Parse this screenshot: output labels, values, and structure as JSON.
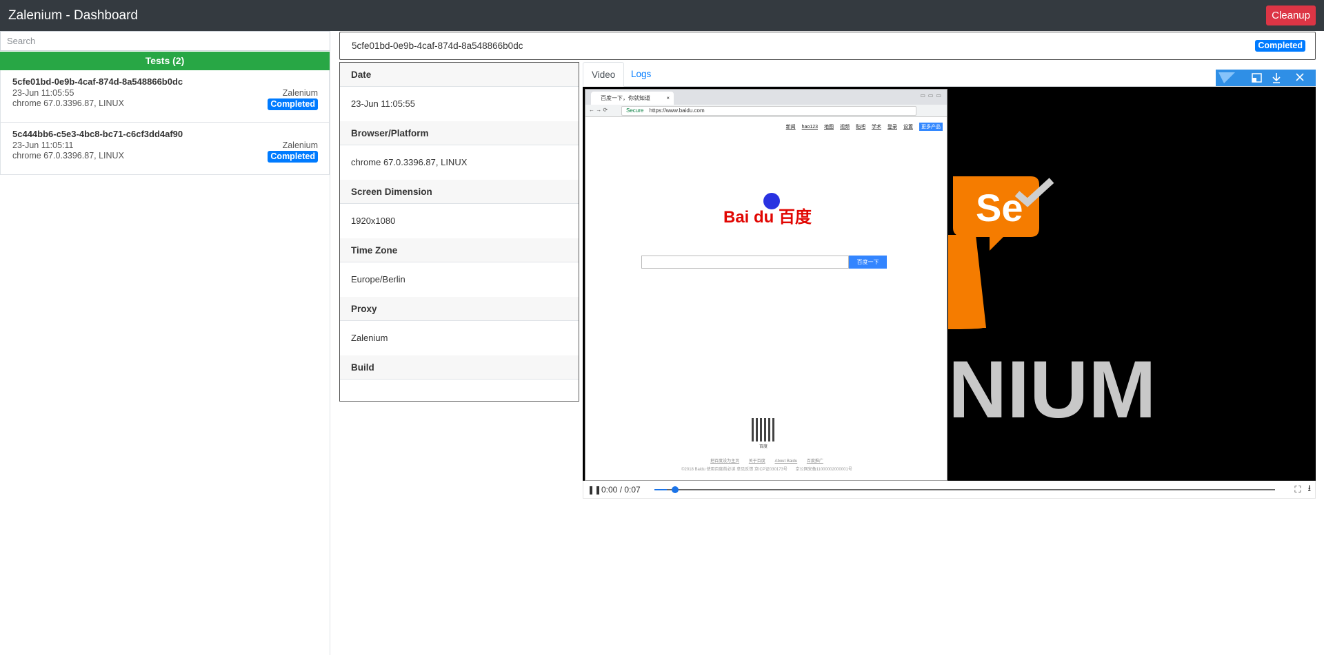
{
  "app": {
    "title": "Zalenium - Dashboard",
    "cleanup_label": "Cleanup"
  },
  "search": {
    "placeholder": "Search"
  },
  "tests": {
    "header": "Tests (2)",
    "items": [
      {
        "id": "5cfe01bd-0e9b-4caf-874d-8a548866b0dc",
        "date": "23-Jun 11:05:55",
        "proxy": "Zalenium",
        "platform": "chrome 67.0.3396.87, LINUX",
        "status": "Completed"
      },
      {
        "id": "5c444bb6-c5e3-4bc8-bc71-c6cf3dd4af90",
        "date": "23-Jun 11:05:11",
        "proxy": "Zalenium",
        "platform": "chrome 67.0.3396.87, LINUX",
        "status": "Completed"
      }
    ]
  },
  "selected": {
    "id": "5cfe01bd-0e9b-4caf-874d-8a548866b0dc",
    "status": "Completed",
    "details": [
      {
        "label": "Date",
        "value": "23-Jun 11:05:55"
      },
      {
        "label": "Browser/Platform",
        "value": "chrome 67.0.3396.87, LINUX"
      },
      {
        "label": "Screen Dimension",
        "value": "1920x1080"
      },
      {
        "label": "Time Zone",
        "value": "Europe/Berlin"
      },
      {
        "label": "Proxy",
        "value": "Zalenium"
      },
      {
        "label": "Build",
        "value": ""
      }
    ]
  },
  "tabs": {
    "video": "Video",
    "logs": "Logs"
  },
  "video": {
    "time": "0:00 / 0:07",
    "progress": 0.02,
    "browser_tab": "百度一下，你就知道",
    "secure": "Secure",
    "url": "https://www.baidu.com",
    "nav_links": [
      "新闻",
      "hao123",
      "地图",
      "视频",
      "贴吧",
      "学术",
      "登录",
      "设置"
    ],
    "more_products": "更多产品",
    "baidu_logo": "Bai du 百度",
    "search_button": "百度一下",
    "qr_label": "百度",
    "footer_links": [
      "把百度设为主页",
      "关于百度",
      "About Baidu",
      "百度推广"
    ],
    "footer_copy": "©2018 Baidu 使用百度前必读 意见反馈 京ICP证030173号",
    "footer_beian": "京公网安备11000002000001号",
    "se_text": "Se",
    "nium_text": "NIUM",
    "accent_orange": "#f57c00"
  }
}
